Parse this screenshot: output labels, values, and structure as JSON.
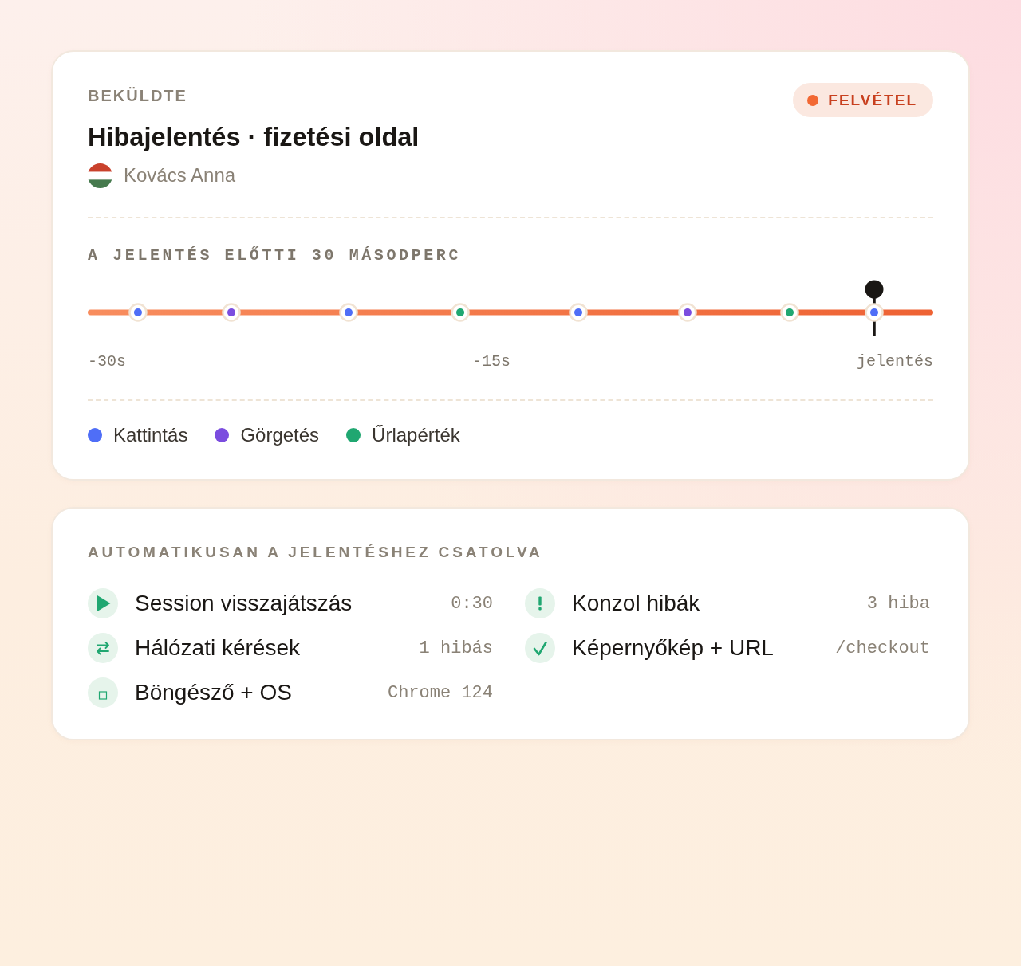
{
  "report": {
    "eyebrow": "BEKÜLDTE",
    "title": "Hibajelentés · fizetési oldal",
    "author": {
      "name": "Kovács Anna"
    },
    "status_badge": {
      "label": "FELVÉTEL"
    }
  },
  "timeline": {
    "title": "A JELENTÉS ELŐTTI 30 MÁSODPERC",
    "events": [
      {
        "color": "#4f6ef7"
      },
      {
        "color": "#7b4ddf"
      },
      {
        "color": "#4f6ef7"
      },
      {
        "color": "#20a771"
      },
      {
        "color": "#4f6ef7"
      },
      {
        "color": "#7b4ddf"
      },
      {
        "color": "#20a771"
      },
      {
        "color": "#4f6ef7"
      }
    ],
    "axis_labels": [
      "-30s",
      "-15s",
      "jelentés"
    ],
    "legend": [
      {
        "label": "Kattintás",
        "color": "#4f6ef7"
      },
      {
        "label": "Görgetés",
        "color": "#7b4ddf"
      },
      {
        "label": "Űrlapérték",
        "color": "#20a771"
      }
    ]
  },
  "attachments": {
    "heading": "AUTOMATIKUSAN A JELENTÉSHEZ CSATOLVA",
    "items": [
      {
        "kind": "replay",
        "label": "Session visszajátszás",
        "value": "0:30"
      },
      {
        "kind": "console",
        "label": "Konzol hibák",
        "value": "3 hiba"
      },
      {
        "kind": "network",
        "label": "Hálózati kérések",
        "value": "1 hibás"
      },
      {
        "kind": "screenshot",
        "label": "Képernyőkép + URL",
        "value": "/checkout"
      },
      {
        "kind": "browser",
        "label": "Böngésző + OS",
        "value": "Chrome 124"
      }
    ]
  }
}
